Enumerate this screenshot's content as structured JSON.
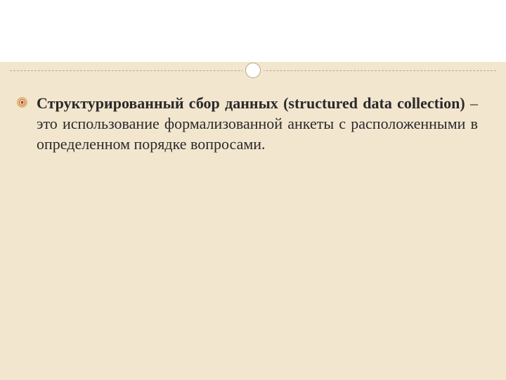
{
  "slide": {
    "bullet": {
      "term": "Структурированный сбор данных (structured data collection)",
      "definition": " – это использование формализованной анкеты с расположенными в определенном порядке вопросами."
    }
  },
  "colors": {
    "background": "#f2e6cf",
    "header_bg": "#ffffff",
    "divider": "#b8a97f",
    "bullet_outer": "#d4a448",
    "bullet_inner": "#c0392b",
    "text": "#2a2a2a"
  }
}
